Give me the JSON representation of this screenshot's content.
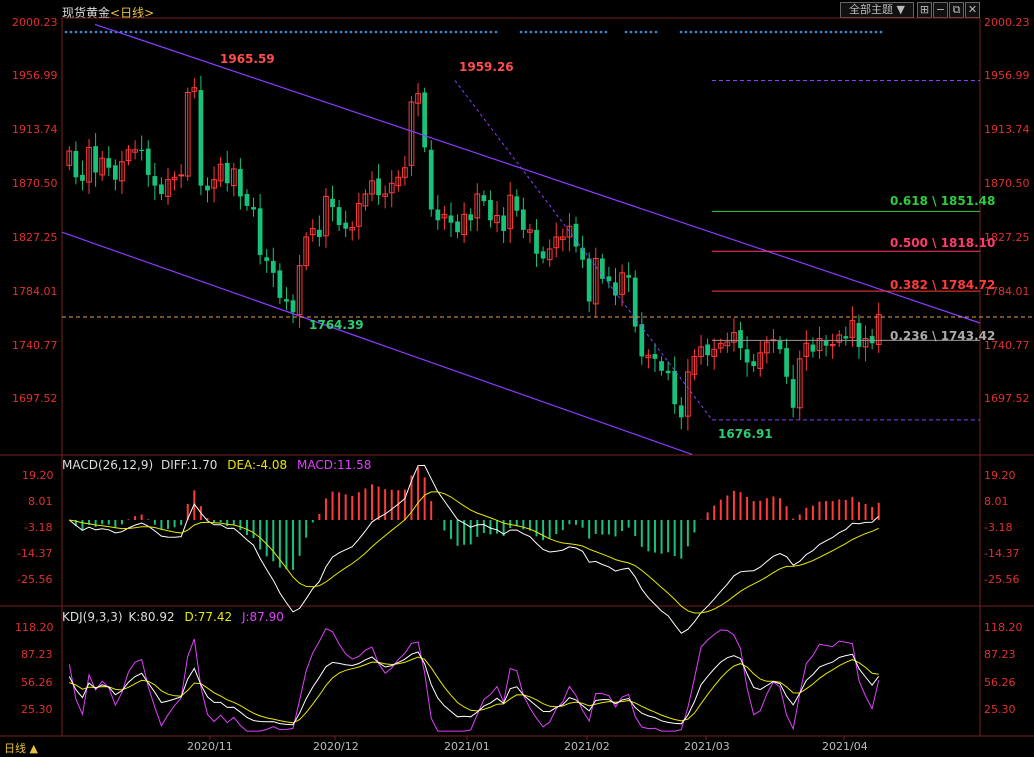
{
  "header": {
    "instrument": "现货黄金",
    "period": "日线",
    "theme_button": "全部主题",
    "icons": [
      "grid-icon",
      "minus-icon",
      "restore-icon",
      "close-icon"
    ]
  },
  "colors": {
    "up": "#ff3b3b",
    "down": "#19c27a",
    "fib_0618": "#2ecc40",
    "fib_0500": "#ff3b6b",
    "fib_0382": "#ff3b3b",
    "fib_0236": "#999999",
    "channel": "#8a3cff",
    "diff": "#ffffff",
    "dea": "#e8e800",
    "kdj_k": "#ffffff",
    "kdj_d": "#e8e800",
    "kdj_j": "#e040fb",
    "axis_text": "#e03030"
  },
  "price_panel": {
    "left_ticks": [
      "2000.23",
      "1956.99",
      "1913.74",
      "1870.50",
      "1827.25",
      "1784.01",
      "1740.77",
      "1697.52"
    ],
    "right_ticks": [
      "2000.23",
      "1956.99",
      "1913.74",
      "1870.50",
      "1827.25",
      "1784.01",
      "1740.77",
      "1697.52"
    ],
    "annotations": [
      "1965.59",
      "1959.26",
      "1764.39",
      "1676.91"
    ],
    "fib_labels": [
      "0.618 \\ 1851.48",
      "0.500 \\ 1818.10",
      "0.382 \\ 1784.72",
      "0.236 \\ 1743.42"
    ]
  },
  "macd_panel": {
    "title": "MACD(26,12,9)",
    "diff_label": "DIFF:1.70",
    "dea_label": "DEA:-4.08",
    "macd_label": "MACD:11.58",
    "ticks": [
      "19.20",
      "8.01",
      "-3.18",
      "-14.37",
      "-25.56"
    ]
  },
  "kdj_panel": {
    "title": "KDJ(9,3,3)",
    "k_label": "K:80.92",
    "d_label": "D:77.42",
    "j_label": "J:87.90",
    "ticks": [
      "118.20",
      "87.23",
      "56.26",
      "25.30"
    ]
  },
  "x_axis": {
    "labels": [
      "2020/11",
      "2020/12",
      "2021/01",
      "2021/02",
      "2021/03",
      "2021/04"
    ],
    "period_button": "日线 ▲"
  },
  "chart_data": [
    {
      "type": "candlestick",
      "title": "现货黄金 日线",
      "ylim": [
        1676.91,
        2000.23
      ],
      "x_labels": [
        "2020/11",
        "2020/12",
        "2021/01",
        "2021/02",
        "2021/03",
        "2021/04"
      ],
      "marked_points": [
        {
          "label": "1965.59",
          "kind": "high"
        },
        {
          "label": "1959.26",
          "kind": "high"
        },
        {
          "label": "1764.39",
          "kind": "low"
        },
        {
          "label": "1676.91",
          "kind": "low"
        }
      ],
      "fibonacci": [
        {
          "ratio": 0.618,
          "price": 1851.48
        },
        {
          "ratio": 0.5,
          "price": 1818.1
        },
        {
          "ratio": 0.382,
          "price": 1784.72
        },
        {
          "ratio": 0.236,
          "price": 1743.42
        }
      ],
      "closes": [
        1902,
        1880,
        1877,
        1905,
        1884,
        1896,
        1888,
        1878,
        1893,
        1903,
        1903,
        1902,
        1882,
        1873,
        1866,
        1878,
        1880,
        1882,
        1951,
        1955,
        1873,
        1869,
        1878,
        1891,
        1875,
        1887,
        1864,
        1856,
        1853,
        1815,
        1810,
        1800,
        1779,
        1776,
        1767,
        1806,
        1830,
        1837,
        1830,
        1864,
        1855,
        1840,
        1837,
        1838,
        1858,
        1866,
        1877,
        1865,
        1866,
        1875,
        1880,
        1888,
        1943,
        1950,
        1905,
        1853,
        1844,
        1849,
        1842,
        1834,
        1849,
        1844,
        1866,
        1860,
        1844,
        1848,
        1835,
        1865,
        1852,
        1836,
        1836,
        1816,
        1812,
        1820,
        1830,
        1830,
        1839,
        1822,
        1811,
        1776,
        1812,
        1795,
        1793,
        1781,
        1800,
        1796,
        1755,
        1730,
        1731,
        1728,
        1718,
        1716,
        1690,
        1679,
        1717,
        1730,
        1738,
        1731,
        1736,
        1741,
        1742,
        1750,
        1737,
        1725,
        1722,
        1733,
        1742,
        1744,
        1736,
        1713,
        1687,
        1728,
        1741,
        1734,
        1745,
        1739,
        1740,
        1748,
        1745,
        1760,
        1738,
        1745,
        1741,
        1765
      ]
    },
    {
      "type": "line",
      "title": "MACD(26,12,9)",
      "series": [
        {
          "name": "DIFF",
          "last": 1.7
        },
        {
          "name": "DEA",
          "last": -4.08
        },
        {
          "name": "MACD",
          "last": 11.58
        }
      ],
      "ylim": [
        -25.56,
        19.2
      ]
    },
    {
      "type": "line",
      "title": "KDJ(9,3,3)",
      "series": [
        {
          "name": "K",
          "last": 80.92
        },
        {
          "name": "D",
          "last": 77.42
        },
        {
          "name": "J",
          "last": 87.9
        }
      ],
      "ylim": [
        25.3,
        118.2
      ]
    }
  ]
}
